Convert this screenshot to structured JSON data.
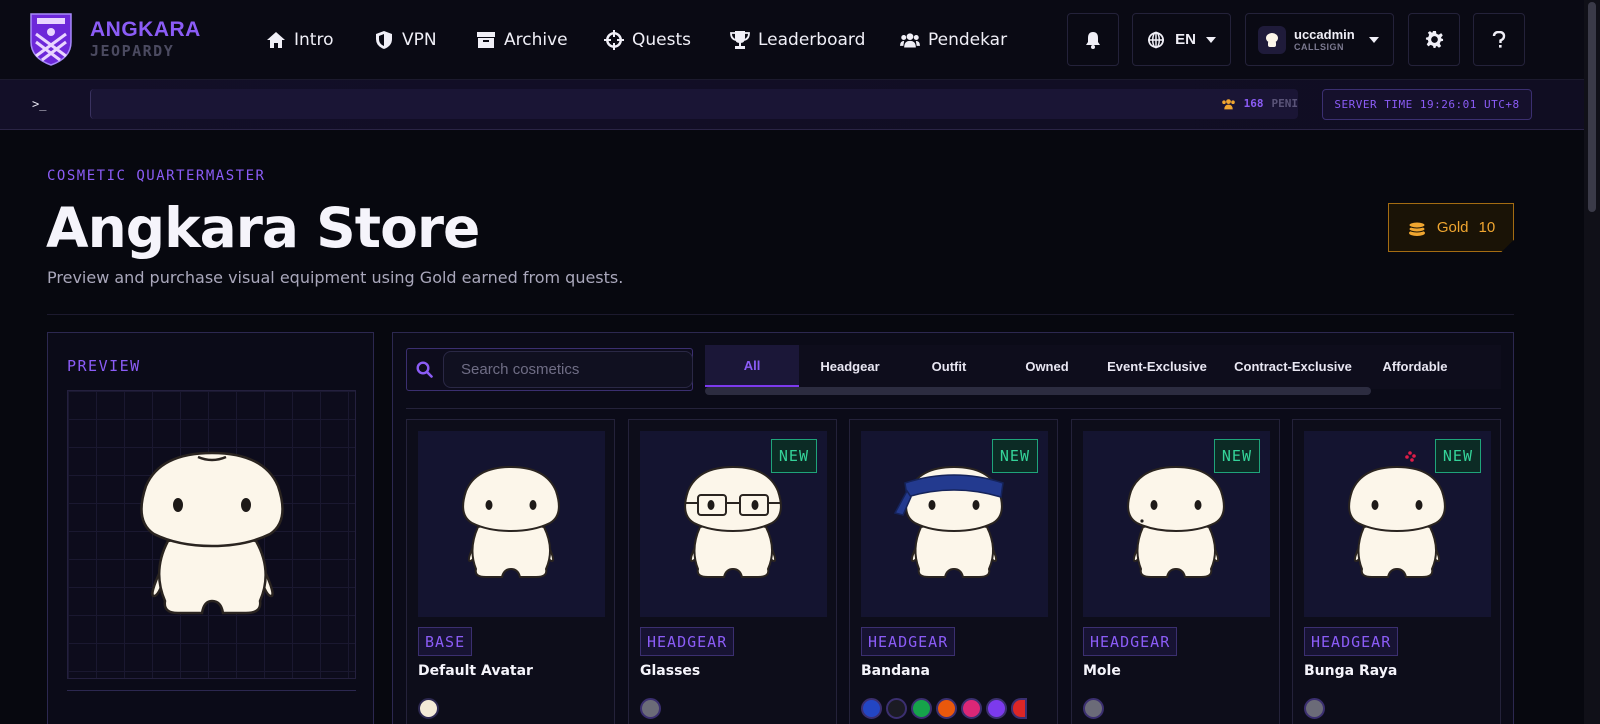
{
  "brand": {
    "line1": "ANGKARA",
    "line2": "JEOPARDY"
  },
  "nav": {
    "items": [
      {
        "label": "Intro",
        "icon": "home-icon"
      },
      {
        "label": "VPN",
        "icon": "shield-icon"
      },
      {
        "label": "Archive",
        "icon": "archive-icon"
      },
      {
        "label": "Quests",
        "icon": "crosshair-icon"
      },
      {
        "label": "Leaderboard",
        "icon": "trophy-icon"
      },
      {
        "label": "Pendekar",
        "icon": "users-icon"
      }
    ],
    "language": "EN",
    "user": {
      "name": "uccadmin",
      "sub": "CALLSIGN"
    }
  },
  "terminal": {
    "prompt": ">_",
    "ticker_count": "168",
    "ticker_text": "PENI",
    "server_time": "SERVER TIME 19:26:01 UTC+8"
  },
  "header": {
    "eyebrow": "COSMETIC QUARTERMASTER",
    "title": "Angkara Store",
    "subtitle": "Preview and purchase visual equipment using Gold earned from quests.",
    "gold_label": "Gold",
    "gold_amount": "10"
  },
  "preview": {
    "label": "PREVIEW"
  },
  "search": {
    "placeholder": "Search cosmetics"
  },
  "tabs": [
    "All",
    "Headgear",
    "Outfit",
    "Owned",
    "Event-Exclusive",
    "Contract-Exclusive",
    "Affordable"
  ],
  "cards": [
    {
      "name": "Default Avatar",
      "category": "BASE",
      "new": ""
    },
    {
      "name": "Glasses",
      "category": "HEADGEAR",
      "new": "NEW"
    },
    {
      "name": "Bandana",
      "category": "HEADGEAR",
      "new": "NEW"
    },
    {
      "name": "Mole",
      "category": "HEADGEAR",
      "new": "NEW"
    },
    {
      "name": "Bunga Raya",
      "category": "HEADGEAR",
      "new": "NEW"
    }
  ],
  "colors": {
    "accent": "#8b5cf6",
    "gold": "#f0a630",
    "new_badge": "#34d399",
    "background": "#07080f",
    "avatar_body": "#fcf6ea"
  }
}
